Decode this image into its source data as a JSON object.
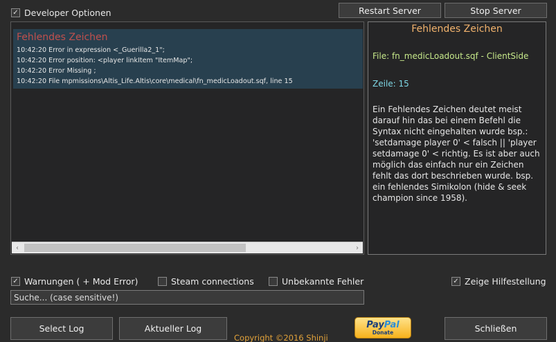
{
  "top": {
    "developer_option": {
      "label": "Developer Optionen",
      "checked": true
    },
    "restart_label": "Restart Server",
    "stop_label": "Stop Server"
  },
  "log": {
    "entry_title": "Fehlendes Zeichen",
    "lines": [
      "10:42:20 Error in expression <_Guerilla2_1\";",
      "10:42:20   Error position: <player linkItem \"ItemMap\";",
      "10:42:20   Error Missing ;",
      "10:42:20 File mpmissions\\Altis_Life.Altis\\core\\medical\\fn_medicLoadout.sqf, line 15"
    ]
  },
  "help": {
    "title": "Fehlendes Zeichen",
    "file": "File: fn_medicLoadout.sqf - ClientSide",
    "line": "Zeile: 15",
    "description": "Ein Fehlendes Zeichen deutet meist darauf hin das bei einem Befehl die Syntax nicht eingehalten wurde bsp.: 'setdamage player 0' < falsch || 'player setdamage 0' < richtig. Es ist aber auch möglich das einfach nur ein Zeichen fehlt das dort beschrieben wurde. bsp. ein fehlendes Simikolon (hide & seek champion since 1958)."
  },
  "filters": {
    "warnings": {
      "label": "Warnungen ( + Mod Error)",
      "checked": true
    },
    "steam": {
      "label": "Steam connections",
      "checked": false
    },
    "unknown": {
      "label": "Unbekannte Fehler",
      "checked": false
    },
    "show_help": {
      "label": "Zeige Hilfestellung",
      "checked": true
    }
  },
  "search": {
    "placeholder": "Suche... (case sensitive!)",
    "value": ""
  },
  "bottom": {
    "select_log_label": "Select Log",
    "current_log_label": "Aktueller Log",
    "copyright": "Copyright ©2016 Shinji",
    "paypal_pay": "Pay",
    "paypal_pal": "Pal",
    "paypal_donate": "Donate",
    "close_label": "Schließen"
  },
  "icons": {
    "check": "✓",
    "arrow_left": "‹",
    "arrow_right": "›"
  },
  "colors": {
    "background": "#2b2b2b",
    "log_entry_bg": "#28404f",
    "error_title": "#c0504d",
    "help_title": "#f2b36d",
    "help_file": "#c6e88a",
    "help_line": "#7fd8e6",
    "copyright": "#e2a23a"
  }
}
